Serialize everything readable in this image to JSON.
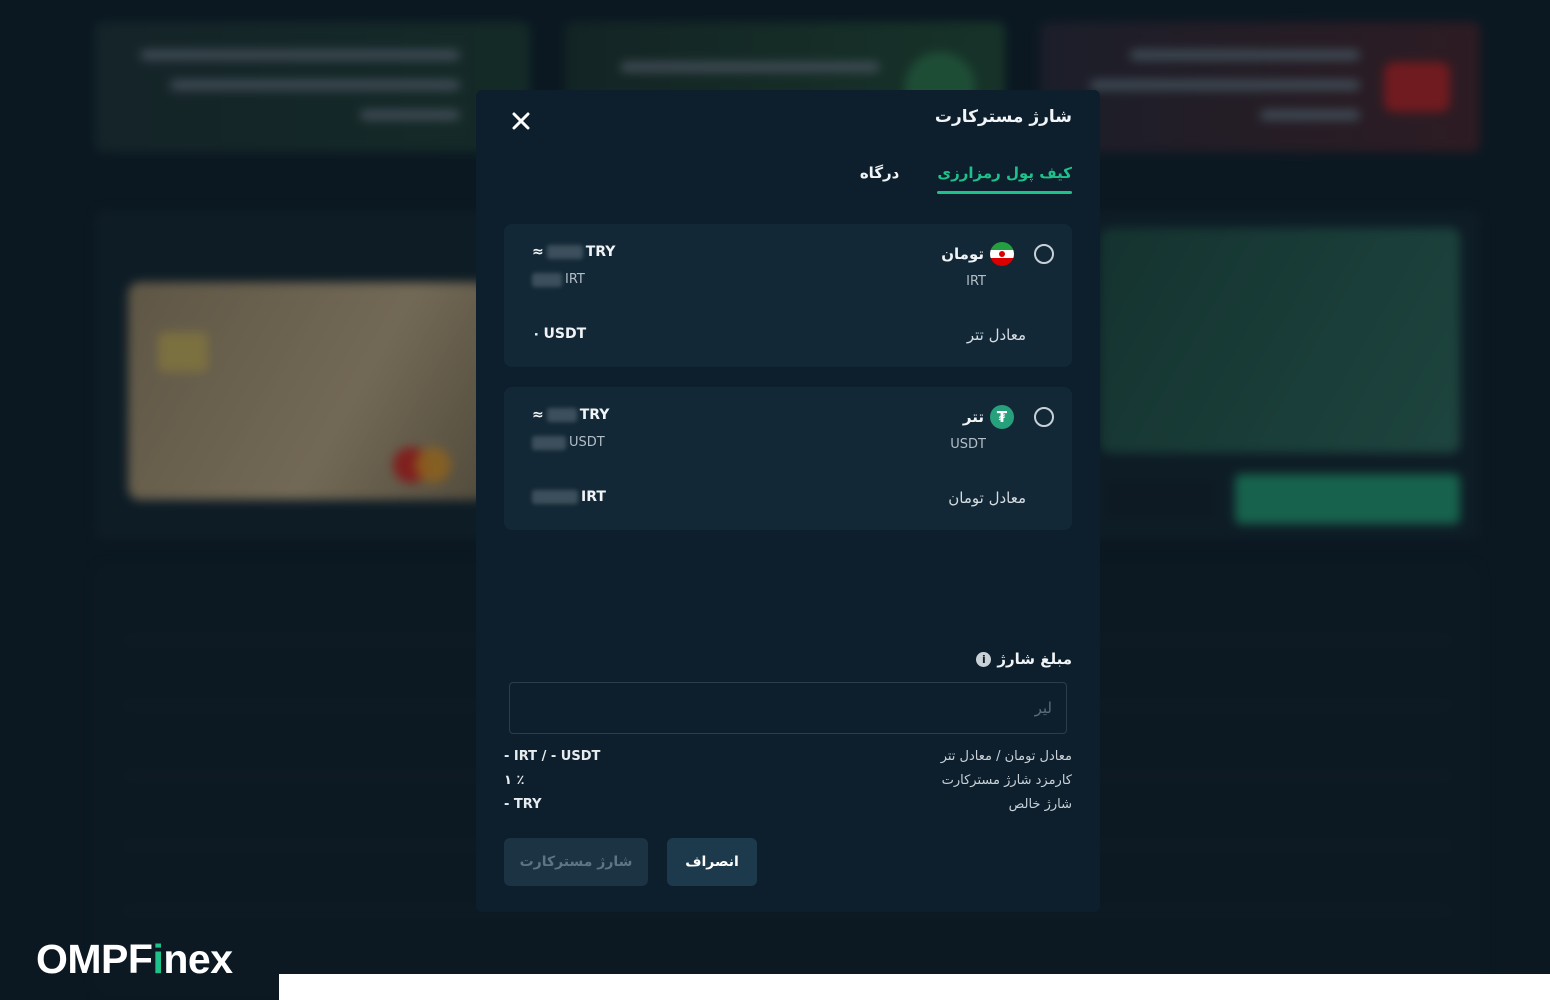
{
  "modal": {
    "title": "شارژ مسترکارت",
    "tabs": [
      {
        "label": "کیف پول رمزارزی",
        "active": true
      },
      {
        "label": "درگاه",
        "active": false
      }
    ],
    "options": [
      {
        "name": "تومان",
        "code": "IRT",
        "icon": "iran-flag-icon",
        "equiv_label": "معادل تتر",
        "try_line": "TRY",
        "approx": "≈",
        "sub_unit": "IRT",
        "equiv_value": "۰",
        "equiv_unit": "USDT"
      },
      {
        "name": "تتر",
        "code": "USDT",
        "icon": "tether-icon",
        "equiv_label": "معادل تومان",
        "try_line": "TRY",
        "approx": "≈",
        "sub_unit": "USDT",
        "equiv_unit": "IRT"
      }
    ],
    "amount": {
      "label": "مبلغ شارژ",
      "placeholder": "لیر",
      "value": ""
    },
    "summary": [
      {
        "key": "معادل تومان / معادل تتر",
        "value": "- IRT / - USDT"
      },
      {
        "key": "کارمزد شارژ مسترکارت",
        "value": "۱ ٪"
      },
      {
        "key": "شارژ خالص",
        "value": "- TRY"
      }
    ],
    "buttons": {
      "cancel": "انصراف",
      "submit": "شارژ مسترکارت"
    }
  },
  "logo": {
    "prefix": "OMPF",
    "i": "i",
    "suffix": "nex"
  },
  "colors": {
    "accent": "#1fc18a",
    "modal_bg": "#0d1f2c",
    "card_bg": "#132836"
  }
}
